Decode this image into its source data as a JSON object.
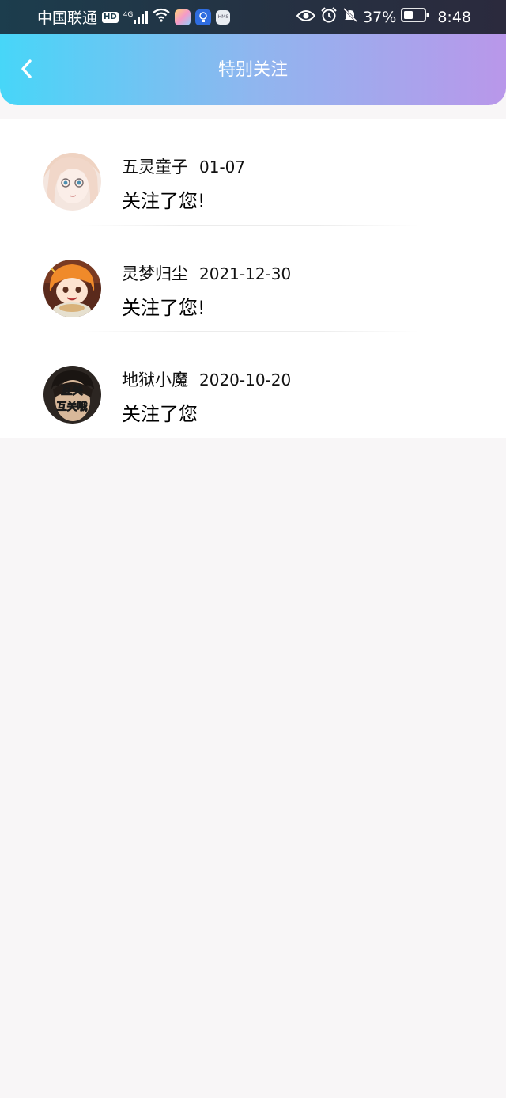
{
  "status_bar": {
    "carrier": "中国联通",
    "hd_badge": "HD",
    "network": "4G",
    "battery": "37%",
    "time": "8:48",
    "icons": [
      "signal-icon",
      "wifi-icon",
      "eye-icon",
      "alarm-icon",
      "mute-bell-icon",
      "battery-icon"
    ]
  },
  "header": {
    "title": "特别关注",
    "back_icon": "chevron-left-icon",
    "gradient": [
      "#47d6f8",
      "#b997ea"
    ]
  },
  "follows": [
    {
      "name": "五灵童子",
      "date": "01-07",
      "message": "关注了您!"
    },
    {
      "name": "灵梦归尘",
      "date": "2021-12-30",
      "message": "关注了您!"
    },
    {
      "name": "地狱小魔",
      "date": "2020-10-20",
      "message": "关注了您",
      "avatar_text": [
        "互关",
        "互关哦"
      ]
    }
  ]
}
